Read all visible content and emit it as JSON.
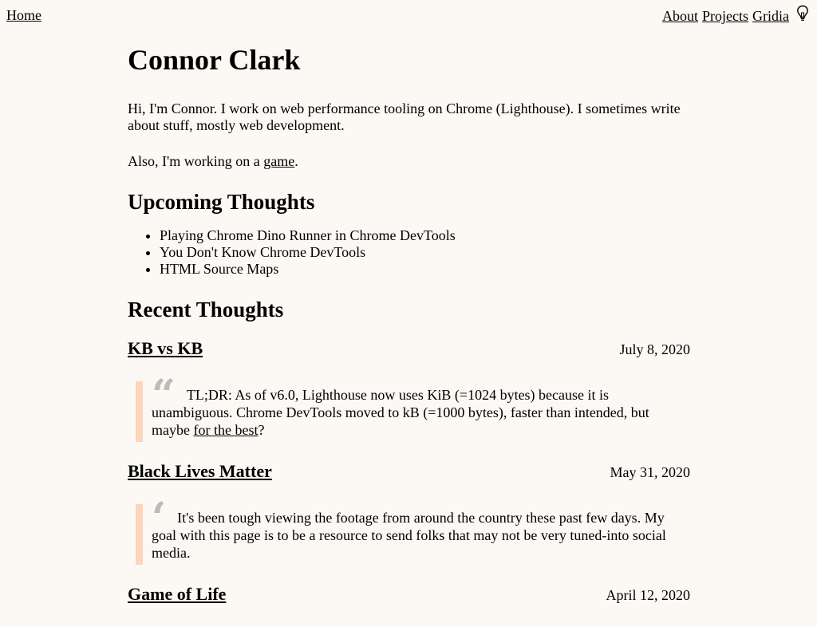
{
  "nav": {
    "home": "Home",
    "about": "About",
    "projects": "Projects",
    "gridia": "Gridia",
    "theme_icon": "lightbulb-icon"
  },
  "header": {
    "title": "Connor Clark"
  },
  "intro": {
    "text": "Hi, I'm Connor. I work on web performance tooling on Chrome (Lighthouse). I sometimes write about stuff, mostly web development.",
    "game_prefix": "Also, I'm working on a ",
    "game_link": "game",
    "game_suffix": "."
  },
  "upcoming": {
    "heading": "Upcoming Thoughts",
    "items": [
      "Playing Chrome Dino Runner in Chrome DevTools",
      "You Don't Know Chrome DevTools",
      "HTML Source Maps"
    ]
  },
  "recent": {
    "heading": "Recent Thoughts",
    "posts": [
      {
        "title": "KB vs KB",
        "date": "July 8, 2020",
        "quote_mark": "“",
        "excerpt": "TL;DR: As of v6.0, Lighthouse now uses KiB (=1024 bytes) because it is unambiguous. Chrome DevTools moved to kB (=1000 bytes), faster than intended, but maybe ",
        "excerpt_link": "for the best",
        "excerpt_suffix": "?"
      },
      {
        "title": "Black Lives Matter",
        "date": "May 31, 2020",
        "quote_mark": "‘",
        "excerpt": "It's been tough viewing the footage from around the country these past few days. My goal with this page is to be a resource to send folks that may not be very tuned-into social media."
      },
      {
        "title": "Game of Life",
        "date": "April 12, 2020"
      }
    ]
  }
}
